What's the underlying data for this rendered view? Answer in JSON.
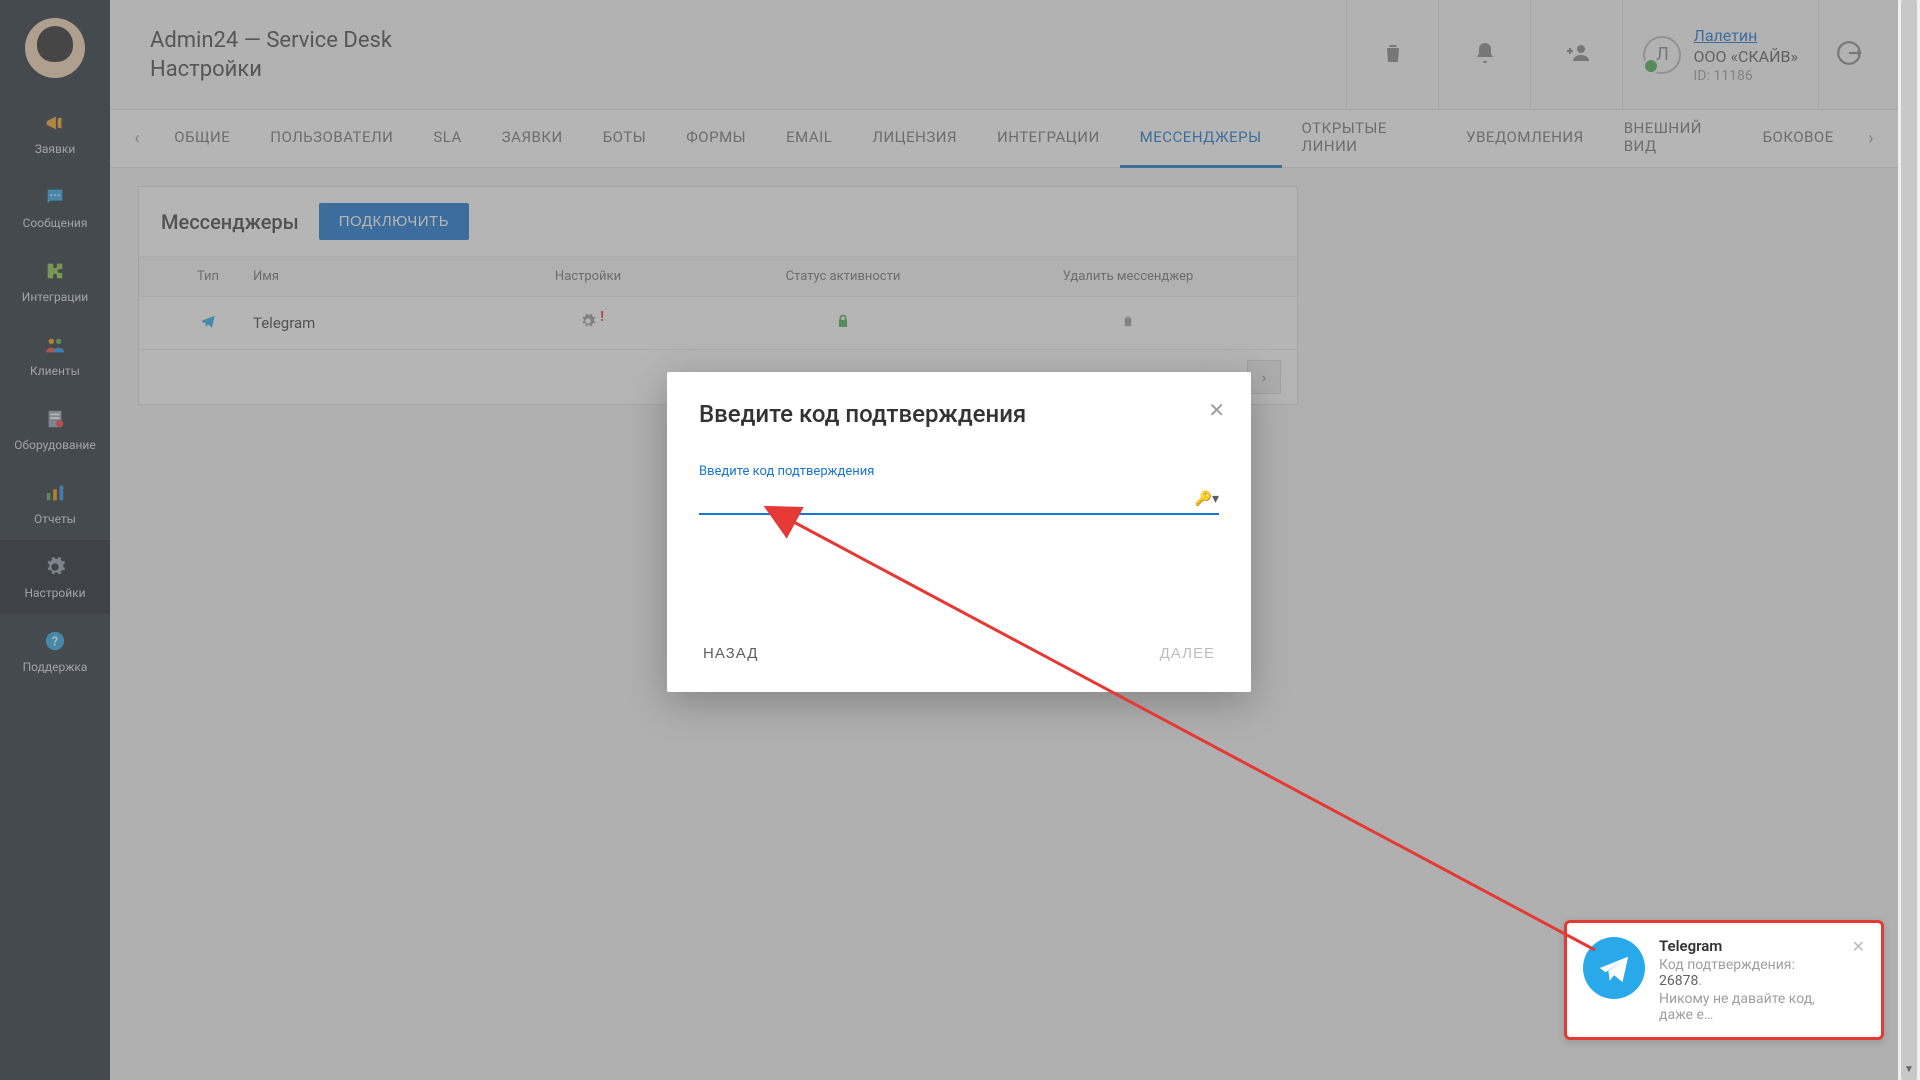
{
  "header": {
    "title": "Admin24 — Service Desk",
    "subtitle": "Настройки"
  },
  "user": {
    "initial": "Л",
    "name": "Лалетин",
    "company": "ООО «СКАЙВ»",
    "id": "ID: 11186"
  },
  "sidebar": {
    "items": [
      {
        "label": "Заявки"
      },
      {
        "label": "Сообщения"
      },
      {
        "label": "Интеграции"
      },
      {
        "label": "Клиенты"
      },
      {
        "label": "Оборудование"
      },
      {
        "label": "Отчеты"
      },
      {
        "label": "Настройки"
      },
      {
        "label": "Поддержка"
      }
    ]
  },
  "tabs": [
    "ОБЩИЕ",
    "ПОЛЬЗОВАТЕЛИ",
    "SLA",
    "ЗАЯВКИ",
    "БОТЫ",
    "ФОРМЫ",
    "EMAIL",
    "ЛИЦЕНЗИЯ",
    "ИНТЕГРАЦИИ",
    "МЕССЕНДЖЕРЫ",
    "ОТКРЫТЫЕ ЛИНИИ",
    "УВЕДОМЛЕНИЯ",
    "ВНЕШНИЙ ВИД",
    "БОКОВОЕ"
  ],
  "active_tab_index": 9,
  "card": {
    "title": "Мессенджеры",
    "connect_label": "ПОДКЛЮЧИТЬ",
    "columns": {
      "type": "Тип",
      "name": "Имя",
      "settings": "Настройки",
      "status": "Статус активности",
      "delete": "Удалить мессенджер"
    },
    "rows": [
      {
        "name": "Telegram"
      }
    ]
  },
  "modal": {
    "title": "Введите код подтверждения",
    "field_label": "Введите код подтверждения",
    "input_value": "",
    "back": "НАЗАД",
    "next": "ДАЛЕЕ"
  },
  "toast": {
    "title": "Telegram",
    "line1_prefix": "Код подтверждения: ",
    "code": "26878",
    "line1_suffix": ".",
    "line2": "Никому не давайте код, даже е…"
  }
}
